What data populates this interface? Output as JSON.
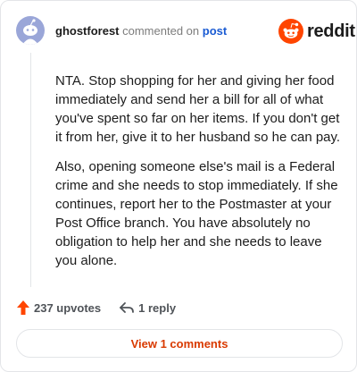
{
  "comment": {
    "username": "ghostforest",
    "action_text": "commented on",
    "post_link": "post",
    "paragraphs": [
      "NTA. Stop shopping for her and giving her food immediately and send her a bill for all of what you've spent so far on her items. If you don't get it from her, give it to her husband so he can pay.",
      "Also, opening someone else's mail is a Federal crime and she needs to stop immediately. If she continues, report her to the Postmaster at your Post Office branch. You have absolutely no obligation to help her and she needs to leave you alone."
    ]
  },
  "brand": {
    "wordmark": "reddit",
    "color": "#ff4500"
  },
  "actions": {
    "upvotes": "237 upvotes",
    "replies": "1 reply",
    "view_comments": "View 1 comments"
  },
  "icons": {
    "avatar": "snoo-avatar-icon",
    "logo": "reddit-snoo-icon",
    "upvote": "upvote-arrow-icon",
    "reply": "reply-arrow-icon"
  },
  "colors": {
    "upvote": "#ff4500",
    "link": "#1a5bd3",
    "view_comments": "#d93a00",
    "avatar_bg": "#9aa6d8"
  }
}
